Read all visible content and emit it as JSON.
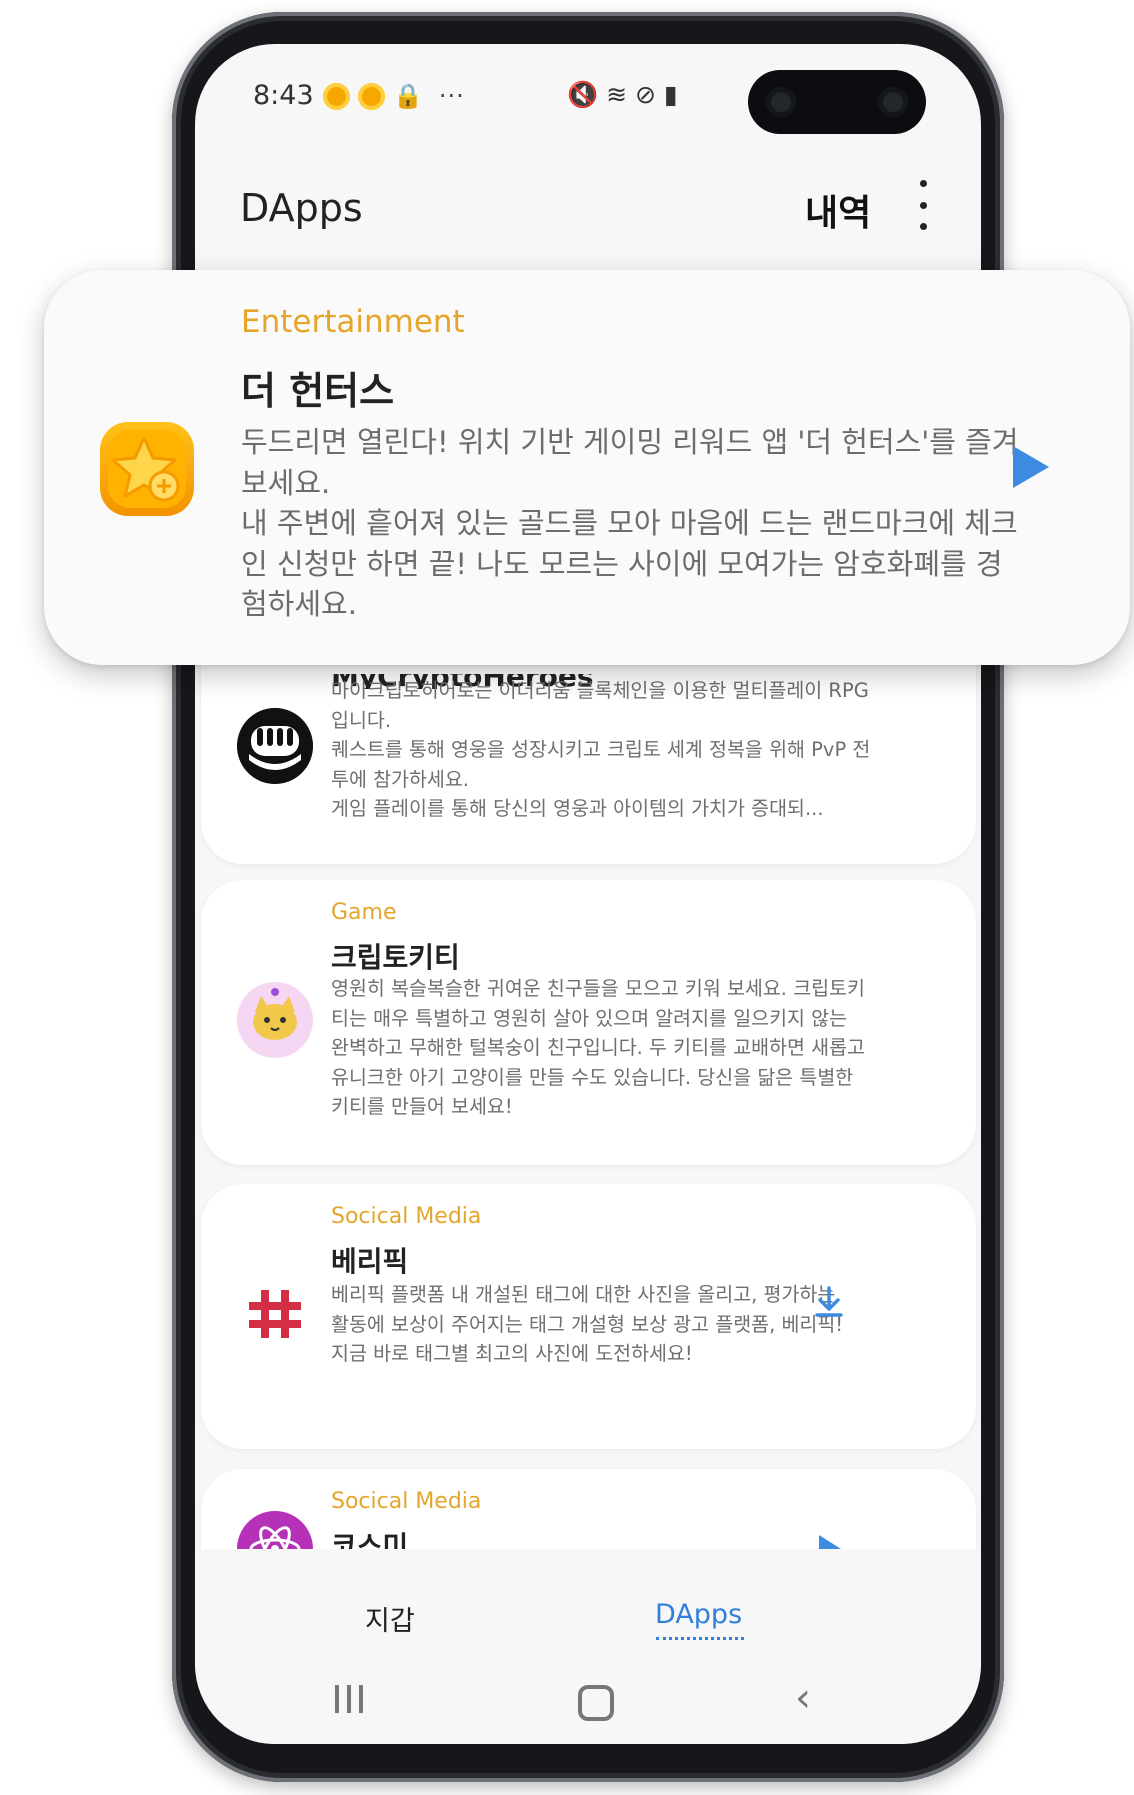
{
  "status_bar": {
    "time": "8:43",
    "left_icons": [
      "notification-coin-icon",
      "notification-coin-icon",
      "lock-icon",
      "more-notifications-icon"
    ],
    "right_icons": [
      "mute-icon",
      "wifi-icon",
      "do-not-disturb-icon",
      "battery-icon"
    ],
    "dots": "···",
    "right_glyphs": "🔇 ≋ ⊘ ▮"
  },
  "app_bar": {
    "title": "DApps",
    "history_label": "내역",
    "more_icon": "more-vertical-icon"
  },
  "featured": {
    "category": "Entertainment",
    "name": "더 헌터스",
    "description": "두드리면 열린다! 위치 기반 게이밍 리워드 앱 '더 헌터스'를 즐겨보세요.\n내 주변에 흩어져 있는 골드를 모아 마음에 드는 랜드마크에 체크인 신청만 하면 끝! 나도 모르는 사이에 모여가는 암호화폐를 경험하세요.",
    "action_icon": "play-icon",
    "accent": "#e5a52a",
    "action_color": "#3d8be0"
  },
  "dapps": [
    {
      "name": "MyCryptoHeroes",
      "description": "마이크립토히어로는 이더리움 블록체인을 이용한 멀티플레이 RPG입니다.\n퀘스트를 통해 영웅을 성장시키고 크립토 세계 정복을 위해 PvP 전투에 참가하세요.\n게임 플레이를 통해 당신의 영웅과 아이템의 가치가 증대되...",
      "icon": "heroes-mask-icon"
    },
    {
      "category": "Game",
      "name": "크립토키티",
      "description": "영원히 복슬복슬한 귀여운 친구들을 모으고 키워 보세요. 크립토키티는 매우 특별하고 영원히 살아 있으며 알려지를 일으키지 않는 완벽하고 무해한 털복숭이 친구입니다. 두 키티를 교배하면 새롭고 유니크한 아기 고양이를 만들 수도 있습니다. 당신을 닮은 특별한 키티를 만들어 보세요!",
      "icon": "cryptokitty-icon"
    },
    {
      "category": "Socical Media",
      "name": "베리픽",
      "description": "베리픽 플랫폼 내 개설된 태그에 대한 사진을 올리고, 평가하는 활동에 보상이 주어지는 태그 개설형 보상 광고 플랫폼, 베리픽!\n지금 바로 태그별 최고의 사진에 도전하세요!",
      "icon": "hashtag-icon",
      "action_icon": "download-icon"
    },
    {
      "category": "Socical Media",
      "name": "코스미",
      "icon": "cosmee-atom-icon",
      "action_icon": "play-icon"
    }
  ],
  "bottom_nav": {
    "wallet_label": "지갑",
    "dapps_label": "DApps",
    "active_color": "#2f7fdd"
  },
  "system_nav": {
    "recents_icon": "recents-icon",
    "home_icon": "home-icon",
    "back_icon": "back-icon",
    "back_glyph": "‹"
  }
}
